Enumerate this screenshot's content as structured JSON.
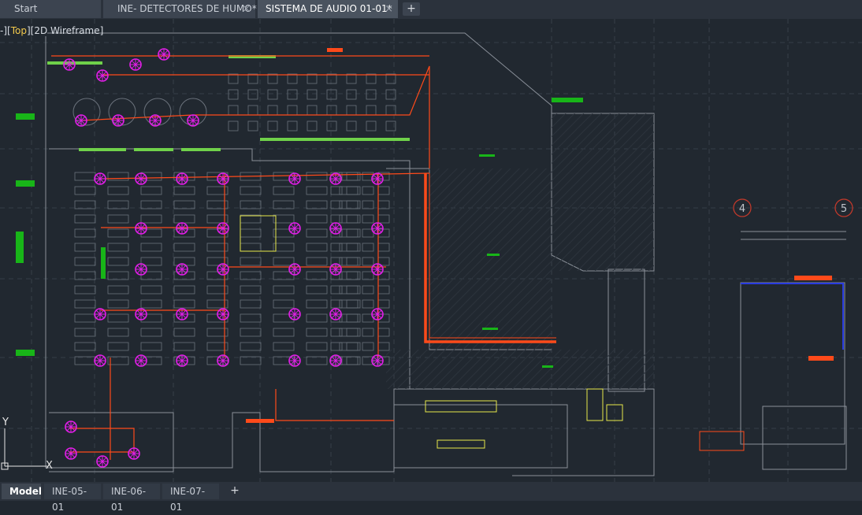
{
  "tabs": [
    {
      "label": "Start",
      "closable": false,
      "active": false
    },
    {
      "label": "INE- DETECTORES DE HUMO*",
      "closable": true,
      "active": false
    },
    {
      "label": "SISTEMA DE AUDIO 01-01*",
      "closable": true,
      "active": true
    }
  ],
  "new_tab_label": "+",
  "close_glyph": "×",
  "viewport_controls": {
    "prefix": "-][",
    "view": "Top",
    "mid": "][",
    "style": "2D Wireframe",
    "suffix": "]"
  },
  "axis_labels": {
    "y": "Y",
    "x": "X"
  },
  "grid_bubbles": [
    "4",
    "5"
  ],
  "layout_tabs": [
    {
      "label": "Model",
      "active": true
    },
    {
      "label": "INE-05-01",
      "active": false
    },
    {
      "label": "INE-06-01",
      "active": false
    },
    {
      "label": "INE-07-01",
      "active": false
    }
  ],
  "layout_add_label": "+",
  "colors": {
    "background": "#212830",
    "linework": "#8a9099",
    "speaker": "#e21ee8",
    "audio_cable": "#ff4a1a",
    "furniture": "#6fd14a",
    "label_green": "#18b518",
    "grid_bubble": "#c0392b",
    "annotation_blue": "#2a3ce0",
    "yellow_elements": "#e8e84a"
  }
}
